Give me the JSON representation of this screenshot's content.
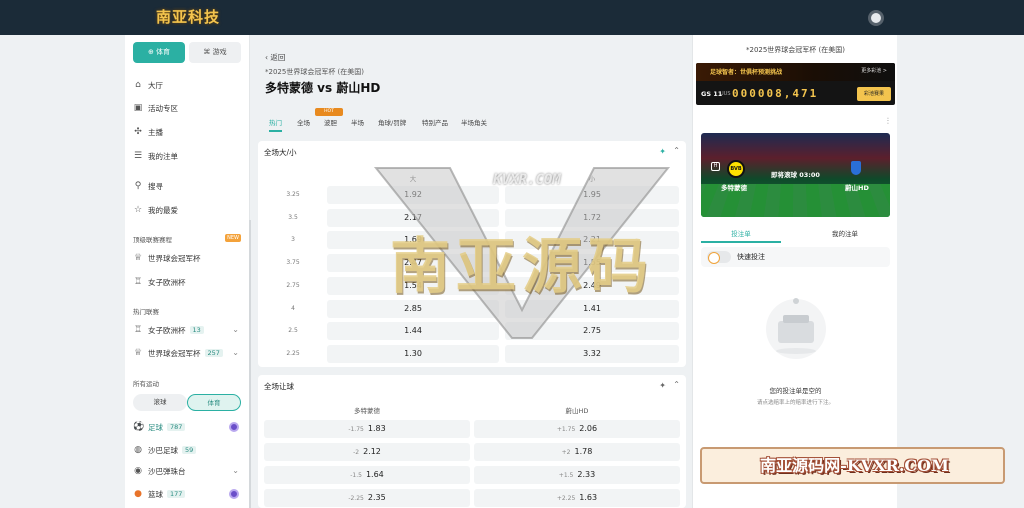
{
  "header": {
    "logo_text": "南亚科技"
  },
  "sidebar": {
    "switch": {
      "sports": "体育",
      "games": "游戏"
    },
    "nav": [
      {
        "icon": "home-icon",
        "label": "大厅"
      },
      {
        "icon": "gift-icon",
        "label": "活动专区"
      },
      {
        "icon": "streamer-icon",
        "label": "主播"
      },
      {
        "icon": "betslip-icon",
        "label": "我的注单"
      }
    ],
    "nav2": [
      {
        "icon": "search-icon",
        "label": "搜寻"
      },
      {
        "icon": "star-icon",
        "label": "我的最爱"
      }
    ],
    "top_leagues_title": "顶级联赛赛程",
    "new_badge": "NEW",
    "top_leagues": [
      {
        "label": "世界球会冠军杯"
      },
      {
        "label": "女子欧洲杯"
      }
    ],
    "hot_leagues_title": "热门联赛",
    "hot_leagues": [
      {
        "label": "女子欧洲杯",
        "count": "13"
      },
      {
        "label": "世界球会冠军杯",
        "count": "257"
      }
    ],
    "all_sports_title": "所有运动",
    "subtoggle": {
      "ball": "滚球",
      "sports": "体育"
    },
    "sports": [
      {
        "label": "足球",
        "count": "787"
      },
      {
        "label": "沙巴足球",
        "count": "59"
      },
      {
        "label": "沙巴弹珠台",
        "count": ""
      },
      {
        "label": "篮球",
        "count": "177"
      }
    ]
  },
  "main": {
    "back": "返回",
    "league": "*2025世界球会冠军杯 (在美国)",
    "title": "多特蒙德 vs 蔚山HD",
    "tabs": [
      "热门",
      "全场",
      "波胆",
      "半场",
      "角球/罚牌",
      "特别产品",
      "半场角关"
    ],
    "tab_badge": "HOT",
    "ou": {
      "title": "全场大/小",
      "col_over": "大",
      "col_under": "小",
      "rows": [
        {
          "line": "3.25",
          "over": "1.92",
          "under": "1.95"
        },
        {
          "line": "3.5",
          "over": "2.17",
          "under": "1.72"
        },
        {
          "line": "3",
          "over": "1.69",
          "under": "2.21"
        },
        {
          "line": "3.75",
          "over": "2.47",
          "under": "1.55"
        },
        {
          "line": "2.75",
          "over": "1.54",
          "under": "2.49"
        },
        {
          "line": "4",
          "over": "2.85",
          "under": "1.41"
        },
        {
          "line": "2.5",
          "over": "1.44",
          "under": "2.75"
        },
        {
          "line": "2.25",
          "over": "1.30",
          "under": "3.32"
        }
      ]
    },
    "hcp": {
      "title": "全场让球",
      "col_home": "多特蒙德",
      "col_away": "蔚山HD",
      "rows": [
        {
          "home_hc": "-1.75",
          "home": "1.83",
          "away_hc": "+1.75",
          "away": "2.06"
        },
        {
          "home_hc": "-2",
          "home": "2.12",
          "away_hc": "+2",
          "away": "1.78"
        },
        {
          "home_hc": "-1.5",
          "home": "1.64",
          "away_hc": "+1.5",
          "away": "2.33"
        },
        {
          "home_hc": "-2.25",
          "home": "2.35",
          "away_hc": "+2.25",
          "away": "1.63"
        }
      ]
    }
  },
  "watermark": {
    "center": "南亚源码",
    "sub": "KVXR.COM",
    "banner": "南亚源码网-KVXR.COM"
  },
  "right": {
    "league": "*2025世界球会冠军杯 (在美国)",
    "promo": {
      "title": "足球智者：世俱杯预测挑战",
      "more": "更多彩池 >",
      "id": "GS 11",
      "sub": "UUS",
      "number": "000008,471",
      "btn": "彩池赛果"
    },
    "hero": {
      "home": "多特蒙德",
      "away": "蔚山HD",
      "time": "即将滚球 03:00",
      "home_crest": "BVB",
      "lock": "H"
    },
    "tabs": [
      "投注单",
      "我的注单"
    ],
    "quick_bet": "快速投注",
    "empty_title": "您的投注单是空的",
    "empty_sub": "请点选赔率上的赔率进行下注。"
  }
}
